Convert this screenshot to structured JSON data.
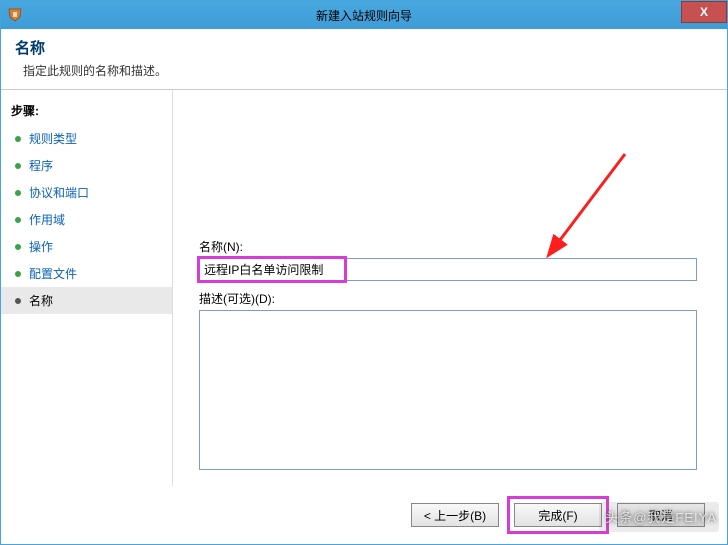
{
  "titlebar": {
    "title": "新建入站规则向导",
    "close": "X"
  },
  "header": {
    "title": "名称",
    "subtitle": "指定此规则的名称和描述。"
  },
  "sidebar": {
    "steps_label": "步骤:",
    "items": [
      {
        "label": "规则类型"
      },
      {
        "label": "程序"
      },
      {
        "label": "协议和端口"
      },
      {
        "label": "作用域"
      },
      {
        "label": "操作"
      },
      {
        "label": "配置文件"
      },
      {
        "label": "名称"
      }
    ]
  },
  "form": {
    "name_label": "名称(N):",
    "name_value": "远程IP白名单访问限制",
    "desc_label": "描述(可选)(D):",
    "desc_value": ""
  },
  "footer": {
    "back": "< 上一步(B)",
    "finish": "完成(F)",
    "cancel": "取消"
  },
  "watermark": "头条@我是FEIYA"
}
